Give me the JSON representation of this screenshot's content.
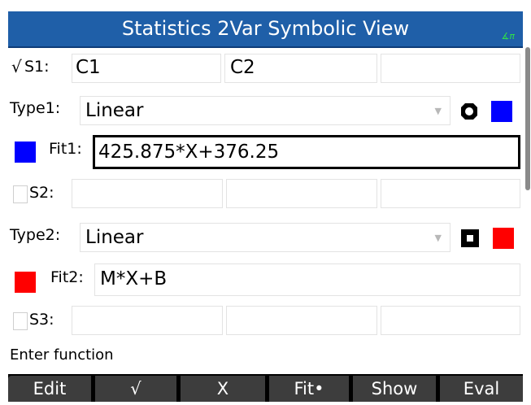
{
  "title": "Statistics 2Var Symbolic View",
  "angle_indicator": "∡π",
  "s1": {
    "check": "√",
    "label": "S1:",
    "col1": "C1",
    "col2": "C2",
    "col3": ""
  },
  "type1": {
    "label": "Type1:",
    "value": "Linear"
  },
  "fit1": {
    "label": "Fit1:",
    "value": "425.875*X+376.25",
    "color": "#0000ff"
  },
  "s2": {
    "label": "S2:",
    "col1": "",
    "col2": "",
    "col3": ""
  },
  "type2": {
    "label": "Type2:",
    "value": "Linear"
  },
  "fit2": {
    "label": "Fit2:",
    "value": "M*X+B",
    "color": "#ff0000"
  },
  "s3": {
    "label": "S3:",
    "col1": "",
    "col2": "",
    "col3": ""
  },
  "status_text": "Enter function",
  "menu": {
    "edit": "Edit",
    "check": "√",
    "x": "X",
    "fit": "Fit•",
    "show": "Show",
    "eval": "Eval"
  }
}
